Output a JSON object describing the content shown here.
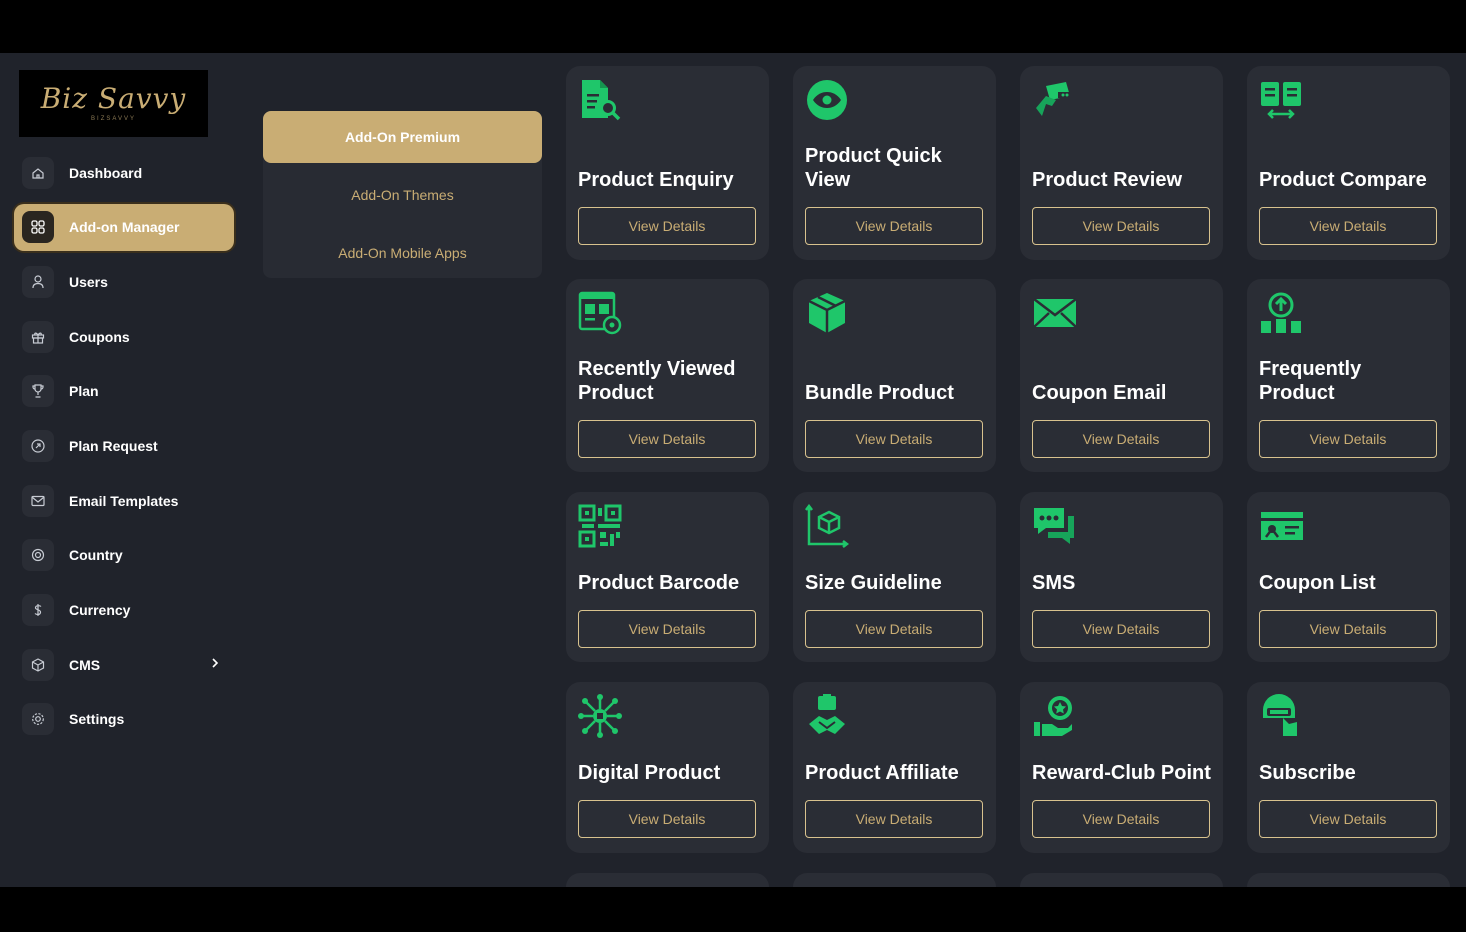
{
  "brand": {
    "logo_text": "Biz Savvy",
    "logo_subtext": "BIZSAVVY"
  },
  "sidebar": {
    "items": [
      {
        "label": "Dashboard",
        "icon": "home-icon"
      },
      {
        "label": "Add-on Manager",
        "icon": "grid-icon",
        "active": true
      },
      {
        "label": "Users",
        "icon": "user-icon"
      },
      {
        "label": "Coupons",
        "icon": "gift-icon"
      },
      {
        "label": "Plan",
        "icon": "trophy-icon"
      },
      {
        "label": "Plan Request",
        "icon": "arrow-circle-icon"
      },
      {
        "label": "Email Templates",
        "icon": "mail-icon"
      },
      {
        "label": "Country",
        "icon": "target-icon"
      },
      {
        "label": "Currency",
        "icon": "dollar-icon"
      },
      {
        "label": "CMS",
        "icon": "box-icon",
        "has_submenu": true
      },
      {
        "label": "Settings",
        "icon": "gear-icon"
      }
    ]
  },
  "addon_tabs": [
    {
      "label": "Add-On Premium",
      "active": true
    },
    {
      "label": "Add-On Themes"
    },
    {
      "label": "Add-On Mobile Apps"
    }
  ],
  "addons": [
    {
      "title": "Product Enquiry",
      "button": "View Details",
      "icon": "document-search-icon"
    },
    {
      "title": "Product Quick View",
      "button": "View Details",
      "icon": "eye-icon"
    },
    {
      "title": "Product Review",
      "button": "View Details",
      "icon": "hand-card-icon"
    },
    {
      "title": "Product Compare",
      "button": "View Details",
      "icon": "compare-icon"
    },
    {
      "title": "Recently Viewed Product",
      "button": "View Details",
      "icon": "browser-eye-icon"
    },
    {
      "title": "Bundle Product",
      "button": "View Details",
      "icon": "package-icon"
    },
    {
      "title": "Coupon Email",
      "button": "View Details",
      "icon": "envelope-icon"
    },
    {
      "title": "Frequently Product",
      "button": "View Details",
      "icon": "upload-boxes-icon"
    },
    {
      "title": "Product Barcode",
      "button": "View Details",
      "icon": "qr-code-icon"
    },
    {
      "title": "Size Guideline",
      "button": "View Details",
      "icon": "cube-measure-icon"
    },
    {
      "title": "SMS",
      "button": "View Details",
      "icon": "chat-bubbles-icon"
    },
    {
      "title": "Coupon List",
      "button": "View Details",
      "icon": "ticket-icon"
    },
    {
      "title": "Digital Product",
      "button": "View Details",
      "icon": "network-icon"
    },
    {
      "title": "Product Affiliate",
      "button": "View Details",
      "icon": "handshake-icon"
    },
    {
      "title": "Reward-Club Point",
      "button": "View Details",
      "icon": "reward-hand-icon"
    },
    {
      "title": "Subscribe",
      "button": "View Details",
      "icon": "subscribe-icon"
    }
  ],
  "colors": {
    "accent": "#c9ad74",
    "icon_green": "#1fc66a",
    "card_bg": "#2a2d35",
    "app_bg": "#20232b"
  }
}
